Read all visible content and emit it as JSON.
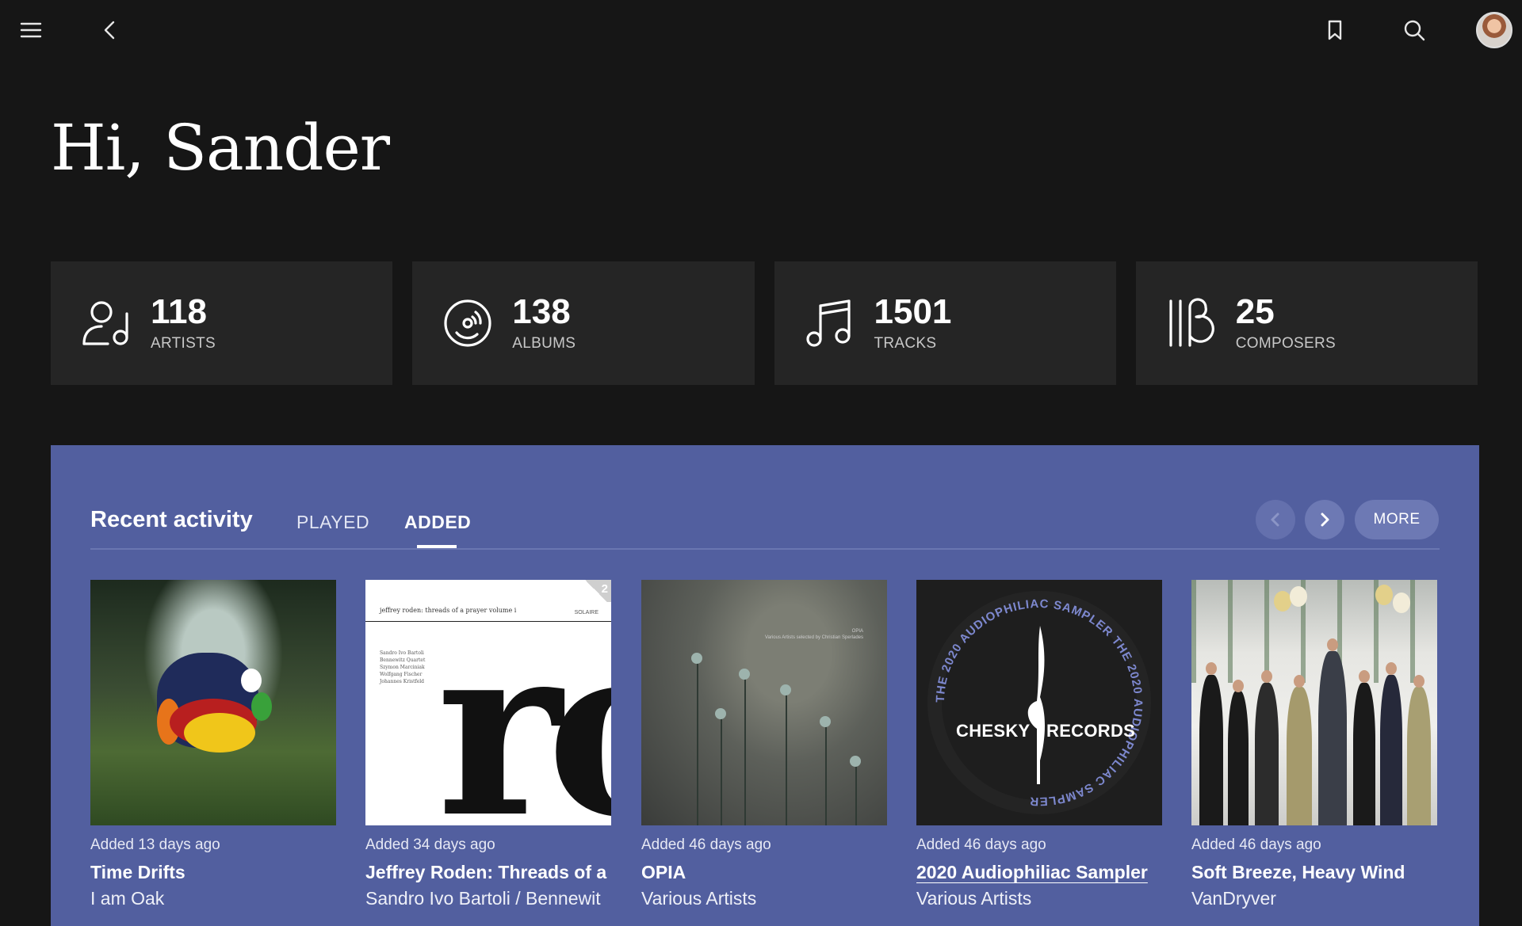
{
  "topbar": {
    "menu_icon": "hamburger-menu-icon",
    "back_icon": "chevron-left-icon",
    "bookmark_icon": "bookmark-icon",
    "search_icon": "search-icon"
  },
  "greeting": "Hi, Sander",
  "stats": [
    {
      "icon": "artist-icon",
      "count": "118",
      "label": "ARTISTS"
    },
    {
      "icon": "album-disc-icon",
      "count": "138",
      "label": "ALBUMS"
    },
    {
      "icon": "music-note-icon",
      "count": "1501",
      "label": "TRACKS"
    },
    {
      "icon": "composer-icon",
      "count": "25",
      "label": "COMPOSERS"
    }
  ],
  "recent": {
    "title": "Recent activity",
    "tabs": [
      {
        "label": "PLAYED",
        "active": false
      },
      {
        "label": "ADDED",
        "active": true
      }
    ],
    "more_label": "MORE",
    "items": [
      {
        "added": "Added 13 days ago",
        "album": "Time Drifts",
        "artist": "I am Oak"
      },
      {
        "added": "Added 34 days ago",
        "album": "Jeffrey Roden: Threads of a Pr",
        "artist": "Sandro Ivo Bartoli / Bennewit"
      },
      {
        "added": "Added 46 days ago",
        "album": "OPIA",
        "artist": "Various Artists"
      },
      {
        "added": "Added 46 days ago",
        "album": "2020 Audiophiliac Sampler",
        "artist": "Various Artists"
      },
      {
        "added": "Added 46 days ago",
        "album": "Soft Breeze, Heavy Wind",
        "artist": "VanDryver"
      }
    ]
  },
  "covers": {
    "jeffrey_header": "jeffrey roden: threads of a prayer   volume i",
    "jeffrey_label": "SOLAIRE",
    "jeffrey_names": "Sandro Ivo Bartoli\nBennewitz Quartet\nSzymon Marciniak\nWolfgang Fischer\nJohannes Kristfeld",
    "jeffrey_big": "ro",
    "jeffrey_disc": "2",
    "opia_title": "OPIA",
    "opia_sub": "Various Artists selected by Christian Sperlades",
    "chesky_left": "CHESKY",
    "chesky_right": "RECORDS",
    "chesky_ring": "THE 2020 AUDIOPHILIAC SAMPLER THE 2020 AUDIOPHILIAC SAMPLER"
  },
  "colors": {
    "background": "#161616",
    "card": "#252525",
    "panel": "#525f9f"
  }
}
